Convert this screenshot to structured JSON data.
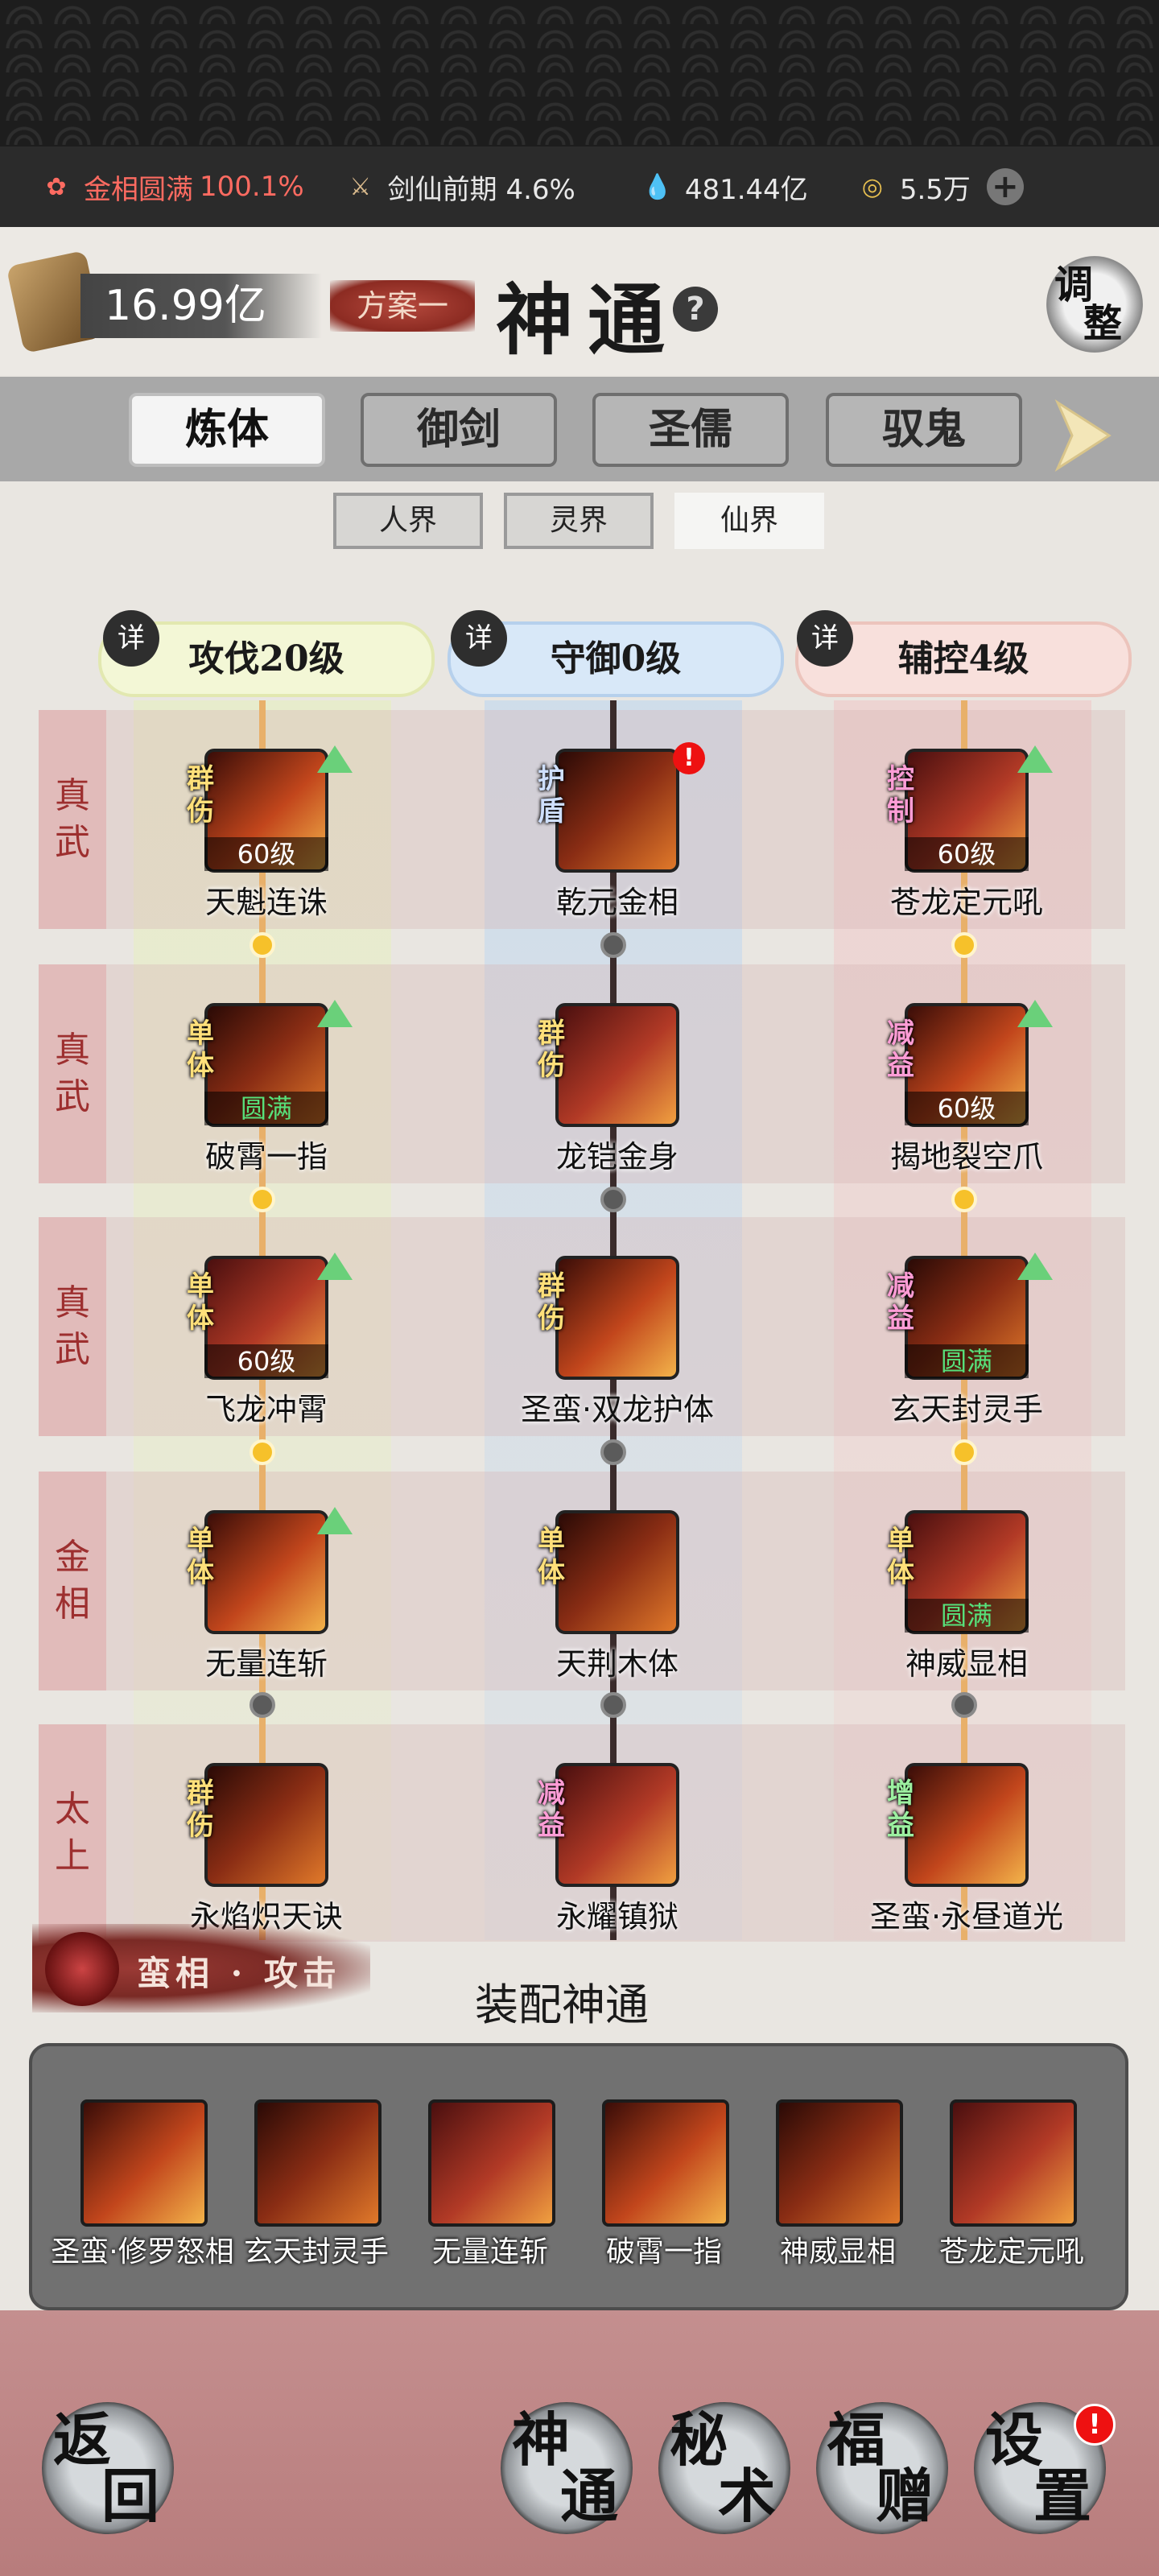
{
  "status_bar": {
    "realm": "金相圆满",
    "realm_pct": "100.1%",
    "sword": "剑仙前期 4.6%",
    "spirit_stones": "481.44亿",
    "coins": "5.5万"
  },
  "header": {
    "currency": "16.99亿",
    "plan": "方案一",
    "title": "神通",
    "help": "?",
    "adjust": [
      "调",
      "整"
    ]
  },
  "tabs": [
    "炼体",
    "御剑",
    "圣儒",
    "驭鬼"
  ],
  "subtabs": [
    "人界",
    "灵界",
    "仙界"
  ],
  "columns": [
    {
      "detail": "详",
      "label": "攻伐20级",
      "color": "#f3f7d6"
    },
    {
      "detail": "详",
      "label": "守御0级",
      "color": "#d8e8f8"
    },
    {
      "detail": "详",
      "label": "辅控4级",
      "color": "#f8e0dc"
    }
  ],
  "rows": [
    {
      "label": [
        "真",
        "武"
      ]
    },
    {
      "label": [
        "真",
        "武"
      ]
    },
    {
      "label": [
        "真",
        "武"
      ]
    },
    {
      "label": [
        "金",
        "相"
      ]
    },
    {
      "label": [
        "太",
        "上"
      ]
    }
  ],
  "skills": [
    [
      {
        "tag": [
          "群",
          "伤"
        ],
        "level": "60级",
        "name": "天魁连诛",
        "up": true
      },
      {
        "tag": [
          "护",
          "盾"
        ],
        "level": "",
        "name": "乾元金相",
        "alert": "!"
      },
      {
        "tag": [
          "控",
          "制"
        ],
        "level": "60级",
        "name": "苍龙定元吼",
        "up": true
      }
    ],
    [
      {
        "tag": [
          "单",
          "体"
        ],
        "level": "圆满",
        "name": "破霄一指",
        "up": true
      },
      {
        "tag": [
          "群",
          "伤"
        ],
        "level": "",
        "name": "龙铠金身"
      },
      {
        "tag": [
          "减",
          "益"
        ],
        "level": "60级",
        "name": "揭地裂空爪",
        "up": true
      }
    ],
    [
      {
        "tag": [
          "单",
          "体"
        ],
        "level": "60级",
        "name": "飞龙冲霄",
        "up": true
      },
      {
        "tag": [
          "群",
          "伤"
        ],
        "level": "",
        "name": "圣蛮·双龙护体"
      },
      {
        "tag": [
          "减",
          "益"
        ],
        "level": "圆满",
        "name": "玄天封灵手",
        "up": true
      }
    ],
    [
      {
        "tag": [
          "单",
          "体"
        ],
        "level": "",
        "name": "无量连斩",
        "up": true
      },
      {
        "tag": [
          "单",
          "体"
        ],
        "level": "",
        "name": "天荆木体"
      },
      {
        "tag": [
          "单",
          "体"
        ],
        "level": "圆满",
        "name": "神威显相"
      }
    ],
    [
      {
        "tag": [
          "群",
          "伤"
        ],
        "level": "",
        "name": "永焰炽天诀"
      },
      {
        "tag": [
          "减",
          "益"
        ],
        "level": "",
        "name": "永耀镇狱"
      },
      {
        "tag": [
          "增",
          "益"
        ],
        "level": "",
        "name": "圣蛮·永昼道光"
      }
    ]
  ],
  "loadout": {
    "label": "蛮相 · 攻击",
    "title": "装配神通",
    "equipped": [
      "圣蛮·修罗怒相",
      "玄天封灵手",
      "无量连斩",
      "破霄一指",
      "神威显相",
      "苍龙定元吼"
    ]
  },
  "nav": {
    "back": [
      "返",
      "回"
    ],
    "items": [
      [
        "神",
        "通"
      ],
      [
        "秘",
        "术"
      ],
      [
        "福",
        "赠"
      ],
      [
        "设",
        "置"
      ]
    ],
    "settings_alert": "!"
  },
  "colors": {
    "gold_node": "#f6c12a",
    "grey_node": "#5b5b5b",
    "accent_red": "#ff6b61"
  }
}
